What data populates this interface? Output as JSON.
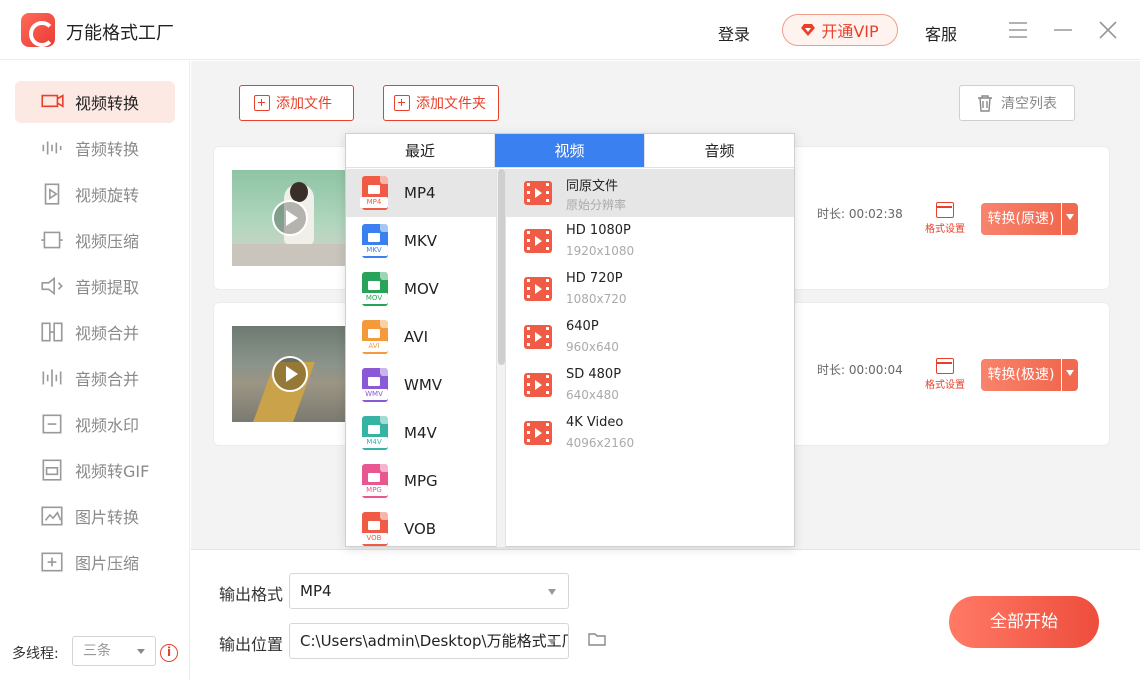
{
  "app": {
    "title": "万能格式工厂"
  },
  "header": {
    "login": "登录",
    "vip": "开通VIP",
    "service": "客服"
  },
  "sidebar": {
    "items": [
      {
        "label": "视频转换",
        "icon": "video-convert-icon",
        "active": true
      },
      {
        "label": "音频转换",
        "icon": "audio-convert-icon"
      },
      {
        "label": "视频旋转",
        "icon": "video-rotate-icon"
      },
      {
        "label": "视频压缩",
        "icon": "video-compress-icon"
      },
      {
        "label": "音频提取",
        "icon": "audio-extract-icon"
      },
      {
        "label": "视频合并",
        "icon": "video-merge-icon"
      },
      {
        "label": "音频合并",
        "icon": "audio-merge-icon"
      },
      {
        "label": "视频水印",
        "icon": "video-watermark-icon"
      },
      {
        "label": "视频转GIF",
        "icon": "gif-icon"
      },
      {
        "label": "图片转换",
        "icon": "image-convert-icon"
      },
      {
        "label": "图片压缩",
        "icon": "image-compress-icon"
      }
    ],
    "threads_label": "多线程:",
    "threads_value": "三条"
  },
  "toolbar": {
    "add_file": "添加文件",
    "add_folder": "添加文件夹",
    "clear_list": "清空列表"
  },
  "files": [
    {
      "duration": "时长: 00:02:38",
      "format_settings": "格式设置",
      "convert": "转换(原速)"
    },
    {
      "duration": "时长: 00:00:04",
      "format_settings": "格式设置",
      "convert": "转换(极速)"
    }
  ],
  "output": {
    "format_label": "输出格式",
    "format_value": "MP4",
    "location_label": "输出位置",
    "location_value": "C:\\Users\\admin\\Desktop\\万能格式工厂",
    "start_all": "全部开始"
  },
  "format_popup": {
    "tabs": [
      {
        "label": "最近"
      },
      {
        "label": "视频",
        "active": true
      },
      {
        "label": "音频"
      }
    ],
    "formats": [
      {
        "name": "MP4",
        "tag": "MP4",
        "color": "#f05b45",
        "selected": true
      },
      {
        "name": "MKV",
        "tag": "MKV",
        "color": "#3a80f0"
      },
      {
        "name": "MOV",
        "tag": "MOV",
        "color": "#2aa35a"
      },
      {
        "name": "AVI",
        "tag": "AVI",
        "color": "#f49a3a"
      },
      {
        "name": "WMV",
        "tag": "WMV",
        "color": "#8a5ad6"
      },
      {
        "name": "M4V",
        "tag": "M4V",
        "color": "#37b3a3"
      },
      {
        "name": "MPG",
        "tag": "MPG",
        "color": "#e8578f"
      },
      {
        "name": "VOB",
        "tag": "VOB",
        "color": "#f05b45"
      }
    ],
    "resolutions": [
      {
        "name": "同原文件",
        "sub": "原始分辨率",
        "selected": true
      },
      {
        "name": "HD 1080P",
        "sub": "1920x1080"
      },
      {
        "name": "HD 720P",
        "sub": "1080x720"
      },
      {
        "name": "640P",
        "sub": "960x640"
      },
      {
        "name": "SD 480P",
        "sub": "640x480"
      },
      {
        "name": "4K Video",
        "sub": "4096x2160"
      }
    ]
  },
  "colors": {
    "accent": "#e8412b",
    "tab_active": "#3a80f0"
  }
}
